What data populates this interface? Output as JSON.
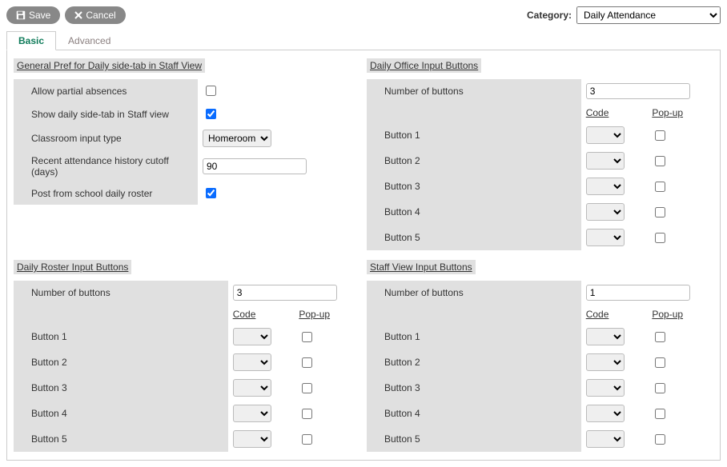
{
  "top": {
    "save_label": "Save",
    "cancel_label": "Cancel",
    "category_label": "Category:",
    "category_value": "Daily Attendance"
  },
  "tabs": {
    "basic": "Basic",
    "advanced": "Advanced"
  },
  "sections": {
    "general": {
      "title": "General Pref for Daily side-tab in Staff View",
      "allow_partial_label": "Allow partial absences",
      "allow_partial_value": false,
      "show_sidetab_label": "Show daily side-tab in Staff view",
      "show_sidetab_value": true,
      "classroom_input_label": "Classroom input type",
      "classroom_input_value": "Homeroom",
      "recent_cutoff_label": "Recent attendance history cutoff (days)",
      "recent_cutoff_value": "90",
      "post_roster_label": "Post from school daily roster",
      "post_roster_value": true
    },
    "office": {
      "title": "Daily Office Input Buttons",
      "num_label": "Number of buttons",
      "num_value": "3"
    },
    "roster": {
      "title": "Daily Roster Input Buttons",
      "num_label": "Number of buttons",
      "num_value": "3"
    },
    "staff": {
      "title": "Staff View Input Buttons",
      "num_label": "Number of buttons",
      "num_value": "1"
    },
    "headers": {
      "code": "Code",
      "popup": "Pop-up"
    },
    "buttons": {
      "b1": "Button 1",
      "b2": "Button 2",
      "b3": "Button 3",
      "b4": "Button 4",
      "b5": "Button 5"
    }
  }
}
